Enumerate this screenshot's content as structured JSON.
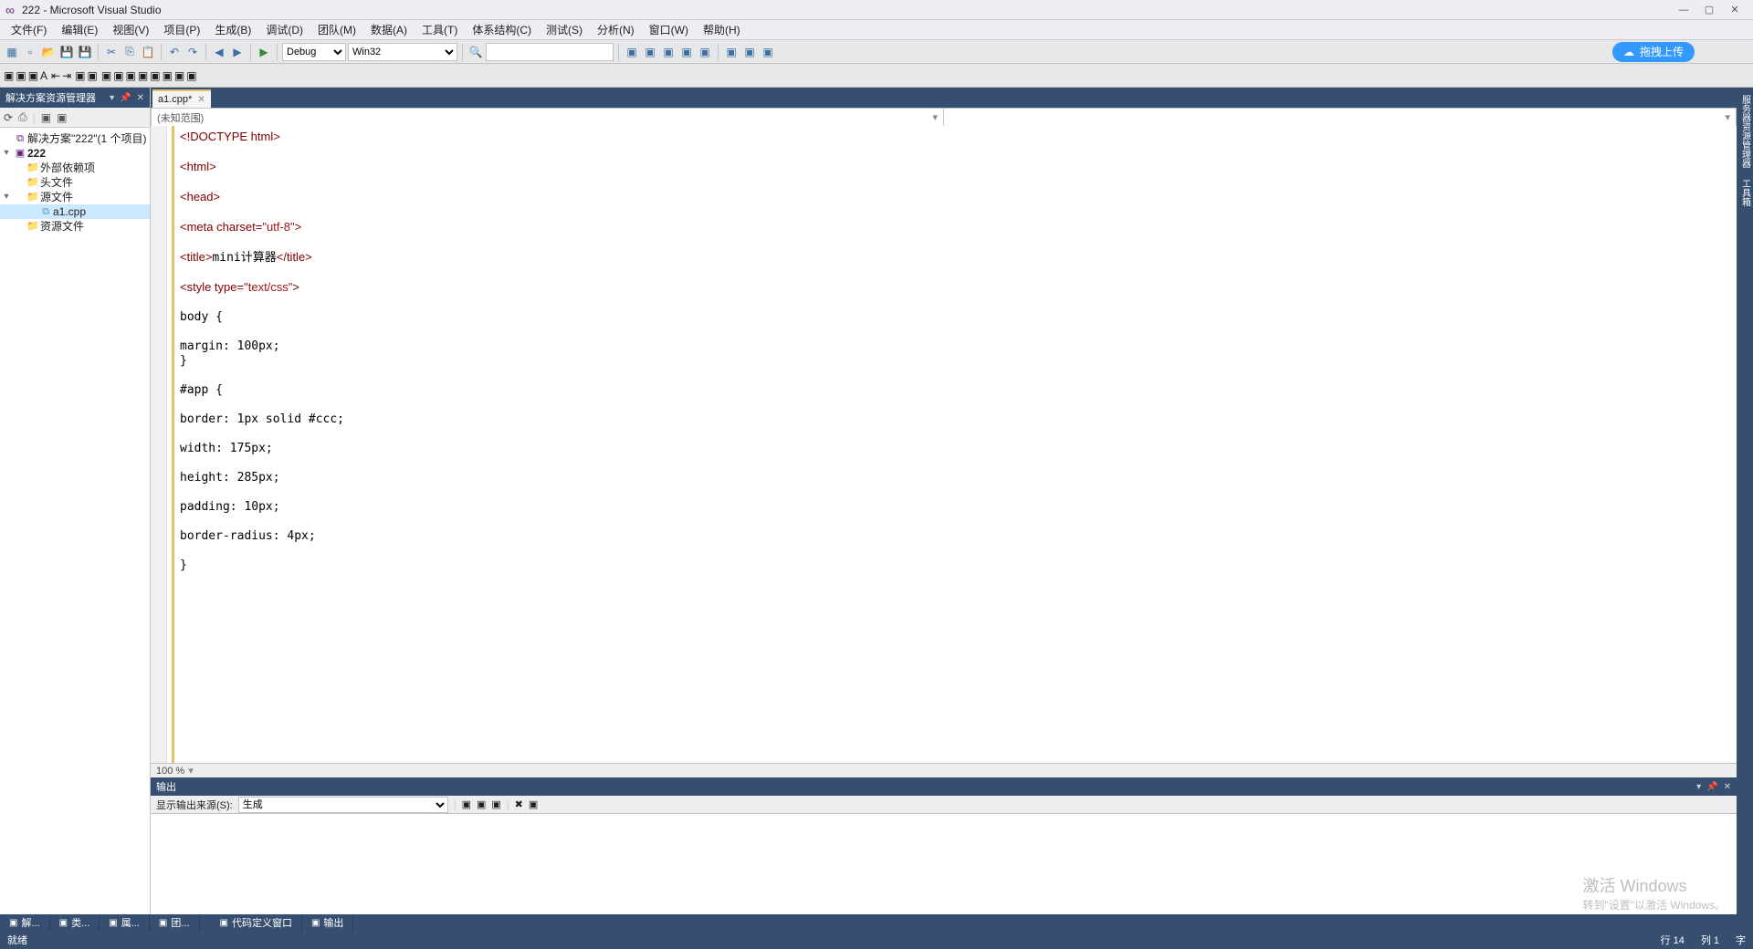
{
  "title": "222 - Microsoft Visual Studio",
  "menu": [
    "文件(F)",
    "编辑(E)",
    "视图(V)",
    "项目(P)",
    "生成(B)",
    "调试(D)",
    "团队(M)",
    "数据(A)",
    "工具(T)",
    "体系结构(C)",
    "测试(S)",
    "分析(N)",
    "窗口(W)",
    "帮助(H)"
  ],
  "toolbar": {
    "config": "Debug",
    "platform": "Win32",
    "search": "",
    "upload": "拖拽上传"
  },
  "solution": {
    "panel_title": "解决方案资源管理器",
    "root": "解决方案\"222\"(1 个项目)",
    "project": "222",
    "folders": {
      "ext": "外部依赖项",
      "hdr": "头文件",
      "src": "源文件",
      "res": "资源文件"
    },
    "file": "a1.cpp"
  },
  "tab": {
    "name": "a1.cpp*",
    "scope": "(未知范围)"
  },
  "code_lines": [
    "<!DOCTYPE html>",
    "",
    "<html>",
    "",
    "<head>",
    "",
    "<meta charset=\"utf-8\">",
    "",
    "<title>mini计算器</title>",
    "",
    "<style type=\"text/css\">",
    "",
    "body {",
    "",
    "margin: 100px;",
    "}",
    "",
    "#app {",
    "",
    "border: 1px solid #ccc;",
    "",
    "width: 175px;",
    "",
    "height: 285px;",
    "",
    "padding: 10px;",
    "",
    "border-radius: 4px;",
    "",
    "}"
  ],
  "zoom": "100 %",
  "output": {
    "title": "输出",
    "src_label": "显示输出来源(S):",
    "src_value": "生成"
  },
  "bottom_tabs_left": [
    "解...",
    "类...",
    "属...",
    "团..."
  ],
  "bottom_tabs_right": [
    "代码定义窗口",
    "输出"
  ],
  "status": {
    "ready": "就绪",
    "line": "行 14",
    "col": "列 1",
    "ch": "字"
  },
  "watermark": {
    "l1": "激活 Windows",
    "l2": "转到\"设置\"以激活 Windows。"
  }
}
